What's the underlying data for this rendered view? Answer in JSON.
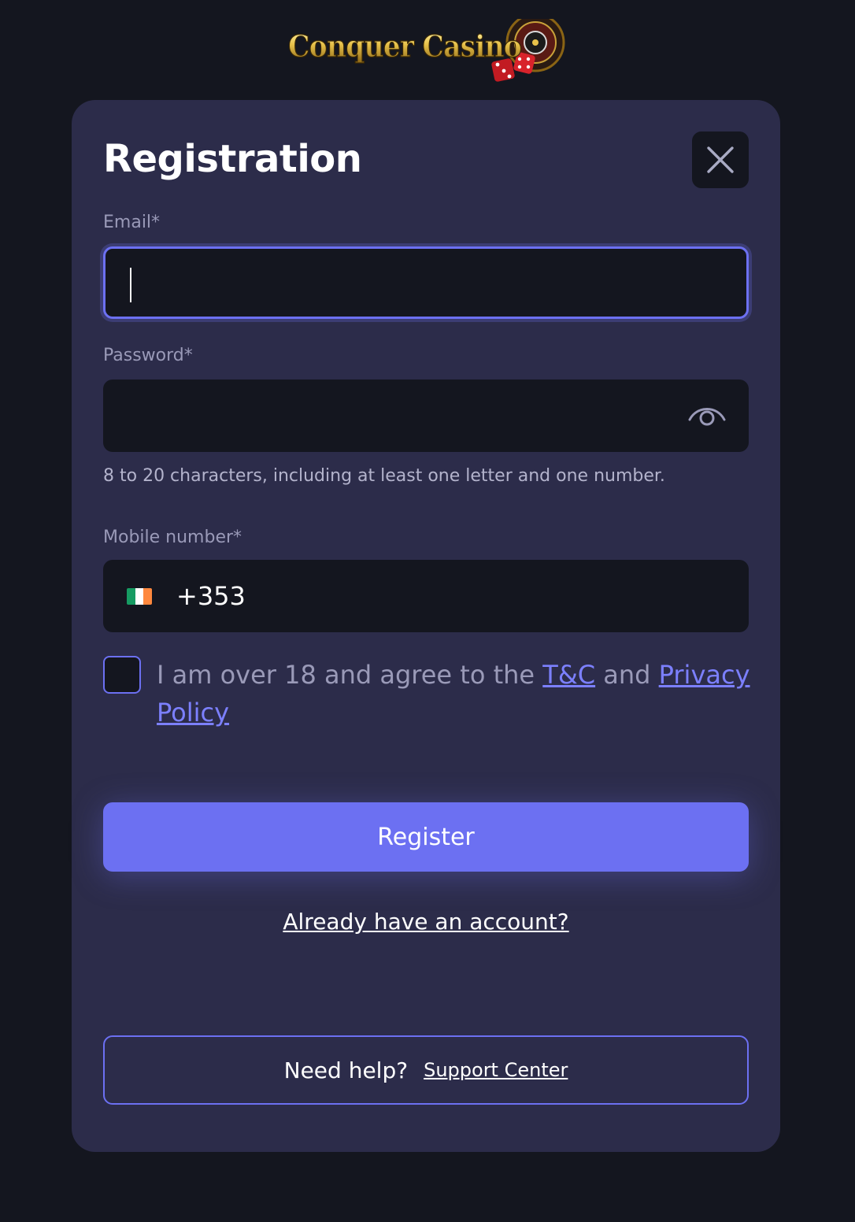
{
  "header": {
    "logo_text": "Conquer Casino"
  },
  "registration": {
    "title": "Registration",
    "email": {
      "label": "Email*",
      "value": "",
      "placeholder": ""
    },
    "password": {
      "label": "Password*",
      "value": "",
      "placeholder": "",
      "hint": "8 to 20 characters, including at least one letter and one number."
    },
    "mobile": {
      "label": "Mobile number*",
      "dial_code": "+353",
      "country_flag": "ireland-flag"
    },
    "consent": {
      "text_before": "I am over 18 and agree to the ",
      "tc_link": "T&C",
      "text_middle": " and ",
      "privacy_link": "Privacy Policy",
      "checked": false
    },
    "register_button": "Register",
    "login_link": "Already have an account?",
    "help": {
      "text": "Need help?",
      "link": "Support Center"
    }
  },
  "colors": {
    "background": "#14161f",
    "modal": "#2c2c4a",
    "accent": "#6c70f2",
    "link": "#7c80ff",
    "muted_text": "#9a9ab8"
  }
}
